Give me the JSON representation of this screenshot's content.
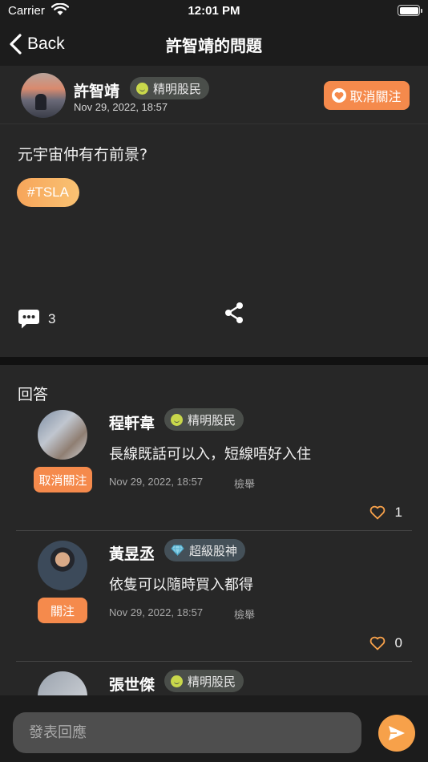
{
  "status_bar": {
    "carrier": "Carrier",
    "time": "12:01 PM"
  },
  "nav": {
    "back_label": "Back",
    "title": "許智靖的問題"
  },
  "question": {
    "author": {
      "name": "許智靖",
      "badge": "精明股民",
      "time": "Nov 29, 2022, 18:57"
    },
    "unfollow_label": "取消關注",
    "text": "元宇宙仲有冇前景?",
    "tag": "#TSLA",
    "comment_count": "3"
  },
  "answers_title": "回答",
  "answers": [
    {
      "name": "程軒韋",
      "badge": "精明股民",
      "text": "長線既話可以入，短線唔好入住",
      "time": "Nov 29, 2022, 18:57",
      "report": "檢舉",
      "follow_label": "取消關注",
      "likes": "1"
    },
    {
      "name": "黃昱丞",
      "badge": "超級股神",
      "text": "依隻可以隨時買入都得",
      "time": "Nov 29, 2022, 18:57",
      "report": "檢舉",
      "follow_label": "關注",
      "likes": "0"
    },
    {
      "name": "張世傑",
      "badge": "精明股民"
    }
  ],
  "reply": {
    "placeholder": "發表回應"
  },
  "icons": {
    "back": "chevron-left-icon",
    "heart": "heart-icon",
    "comment": "comment-bubble-icon",
    "share": "share-icon",
    "like": "heart-outline-icon",
    "badge_smart": "smiley-icon",
    "badge_super": "diamond-icon",
    "send": "paper-plane-icon"
  },
  "colors": {
    "accent": "#f58a4c",
    "tag": "#f7a55a",
    "background": "#1c1c1c",
    "card": "#272727"
  }
}
